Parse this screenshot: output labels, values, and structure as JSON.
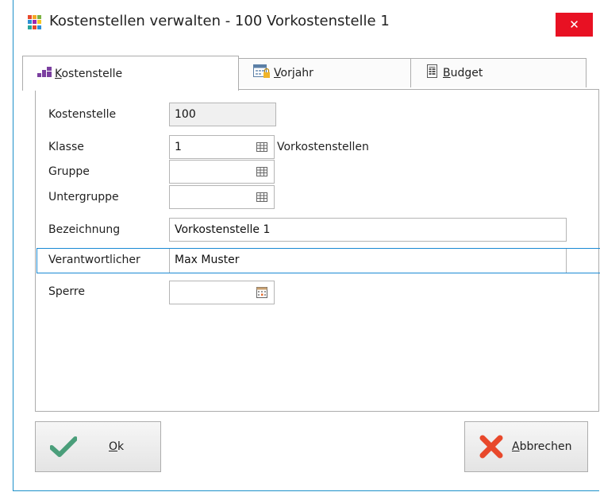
{
  "window": {
    "title": "Kostenstellen verwalten - 100 Vorkostenstelle 1",
    "close_glyph": "✕"
  },
  "tabs": [
    {
      "name": "tab-kostenstelle",
      "icon": "bars-icon",
      "accel": "K",
      "rest": "ostenstelle",
      "active": true
    },
    {
      "name": "tab-vorjahr",
      "icon": "calendar-lock-icon",
      "accel": "V",
      "rest": "orjahr",
      "active": false
    },
    {
      "name": "tab-budget",
      "icon": "document-icon",
      "accel": "B",
      "rest": "udget",
      "active": false
    }
  ],
  "form": {
    "kostenstelle": {
      "label": "Kostenstelle",
      "value": "100"
    },
    "klasse": {
      "label": "Klasse",
      "value": "1",
      "description": "Vorkostenstellen"
    },
    "gruppe": {
      "label": "Gruppe",
      "value": ""
    },
    "untergruppe": {
      "label": "Untergruppe",
      "value": ""
    },
    "bezeichnung": {
      "label": "Bezeichnung",
      "value": "Vorkostenstelle 1"
    },
    "verantwortlicher": {
      "label": "Verantwortlicher",
      "value": "Max Muster"
    },
    "sperre": {
      "label": "Sperre",
      "value": ""
    }
  },
  "buttons": {
    "ok": {
      "accel": "O",
      "rest": "k",
      "icon": "checkmark-icon"
    },
    "cancel": {
      "accel": "A",
      "rest": "bbrechen",
      "icon": "cross-icon"
    }
  },
  "colors": {
    "accent": "#1a8ad4",
    "close": "#e81123",
    "ok_green": "#4a9e7a",
    "cancel_red": "#e8482b"
  }
}
